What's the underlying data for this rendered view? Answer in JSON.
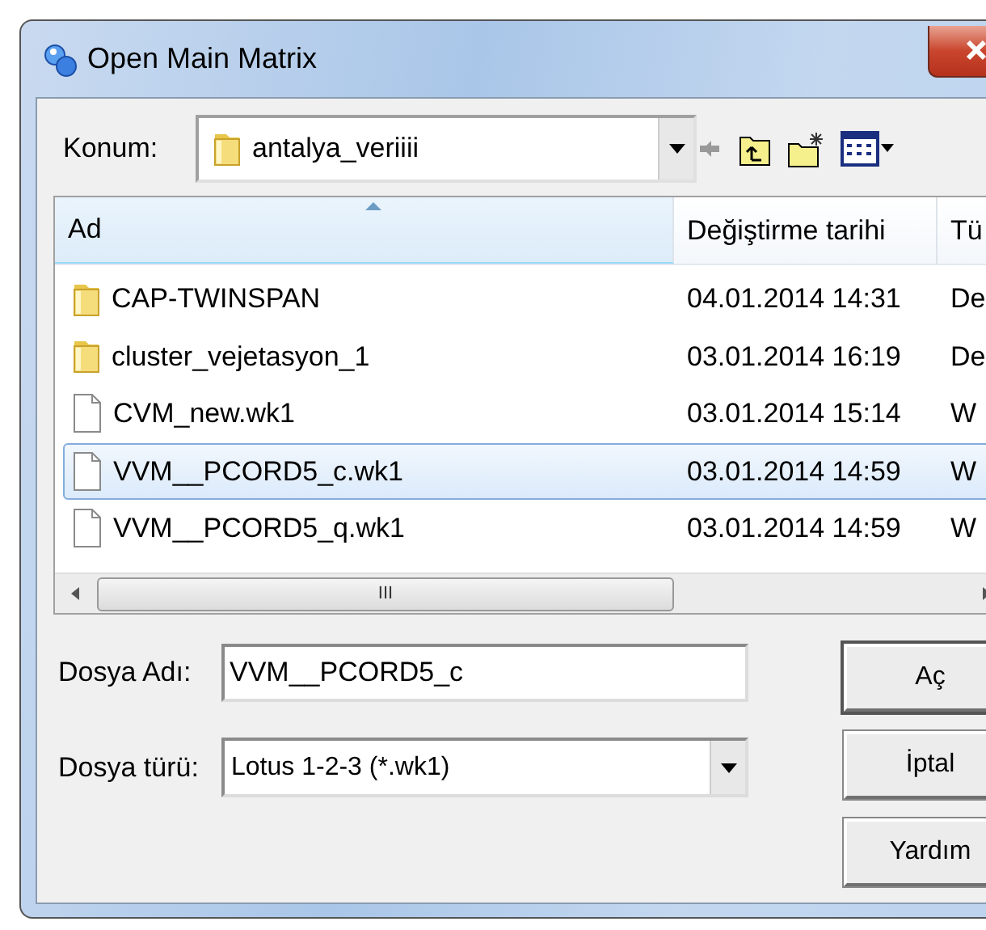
{
  "window": {
    "title": "Open Main Matrix"
  },
  "location": {
    "label": "Konum:",
    "value": "antalya_veriiii"
  },
  "toolbar": [
    {
      "kind": "up-folder"
    },
    {
      "kind": "new-folder"
    },
    {
      "kind": "view-menu"
    }
  ],
  "file_list": {
    "columns": [
      {
        "label": "Ad",
        "sorted": true
      },
      {
        "label": "Değiştirme tarihi",
        "sorted": false
      },
      {
        "label": "Tü",
        "sorted": false
      }
    ],
    "rows": [
      {
        "kind": "folder",
        "name": "CAP-TWINSPAN",
        "modified": "04.01.2014 14:31",
        "type": "De",
        "selected": false
      },
      {
        "kind": "folder",
        "name": "cluster_vejetasyon_1",
        "modified": "03.01.2014 16:19",
        "type": "De",
        "selected": false
      },
      {
        "kind": "file",
        "name": "CVM_new.wk1",
        "modified": "03.01.2014 15:14",
        "type": "W",
        "selected": false
      },
      {
        "kind": "file",
        "name": "VVM__PCORD5_c.wk1",
        "modified": "03.01.2014 14:59",
        "type": "W",
        "selected": true
      },
      {
        "kind": "file",
        "name": "VVM__PCORD5_q.wk1",
        "modified": "03.01.2014 14:59",
        "type": "W",
        "selected": false
      }
    ],
    "scroll_thumb": "III"
  },
  "file_name": {
    "label": "Dosya Adı:",
    "value": "VVM__PCORD5_c"
  },
  "file_type": {
    "label": "Dosya türü:",
    "value": "Lotus 1-2-3 (*.wk1)"
  },
  "buttons": [
    "Aç",
    "İptal",
    "Yardım"
  ]
}
